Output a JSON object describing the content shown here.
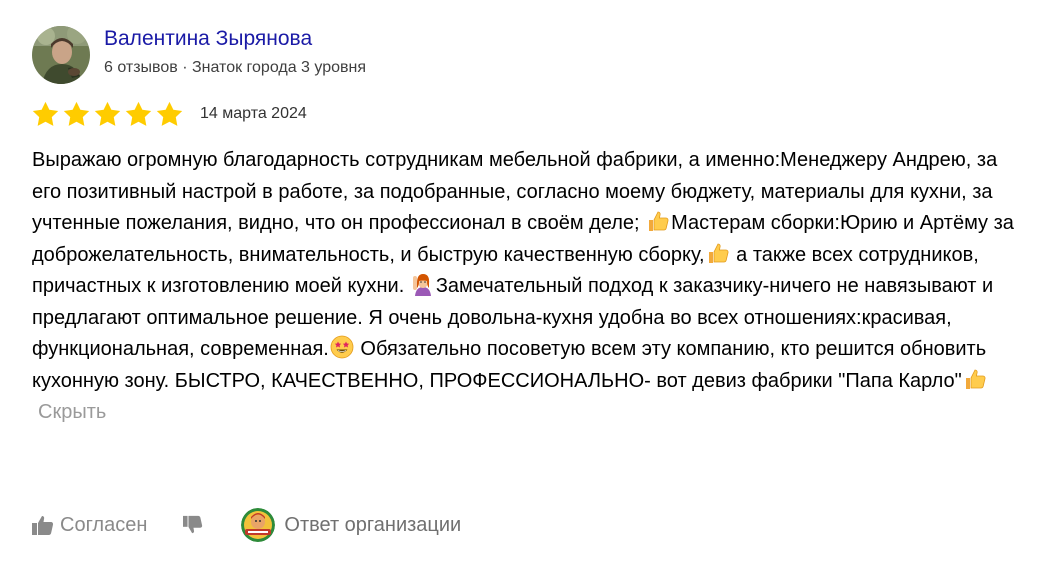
{
  "author": {
    "name": "Валентина Зырянова",
    "meta": "6 отзывов · Знаток города 3 уровня"
  },
  "rating": {
    "value": 5,
    "max": 5,
    "color": "#fc0"
  },
  "review": {
    "date": "14 марта 2024",
    "text_parts": [
      "Выражаю огромную благодарность сотрудникам мебельной фабрики, а именно:Менеджеру Андрею, за его позитивный настрой в работе, за подобранные, согласно моему бюджету, материалы для кухни, за учтенные пожелания, видно, что он профессионал в своём деле; ",
      "Мастерам сборки:Юрию и Артёму за доброжелательность, внимательность, и быструю качественную сборку,",
      " а также всех сотрудников, причастных к изготовлению моей кухни. ",
      "Замечательный подход к заказчику-ничего не навязывают и предлагают оптимальное решение. Я очень довольна-кухня удобна во всех отношениях:красивая, функциональная, современная.",
      " Обязательно посоветую всем эту компанию, кто решится обновить кухонную зону. БЫСТРО, КАЧЕСТВЕННО, ПРОФЕССИОНАЛЬНО- вот девиз фабрики \"Папа Карло\""
    ],
    "emoji": [
      "thumbs-up",
      "thumbs-up",
      "woman-raising-hand",
      "star-struck",
      "thumbs-up"
    ],
    "hide_label": "Скрыть"
  },
  "actions": {
    "like_label": "Согласен",
    "org_reply_label": "Ответ организации"
  },
  "colors": {
    "author_link": "#1a1aa6",
    "muted": "#8a8a8a",
    "star": "#fc0"
  }
}
